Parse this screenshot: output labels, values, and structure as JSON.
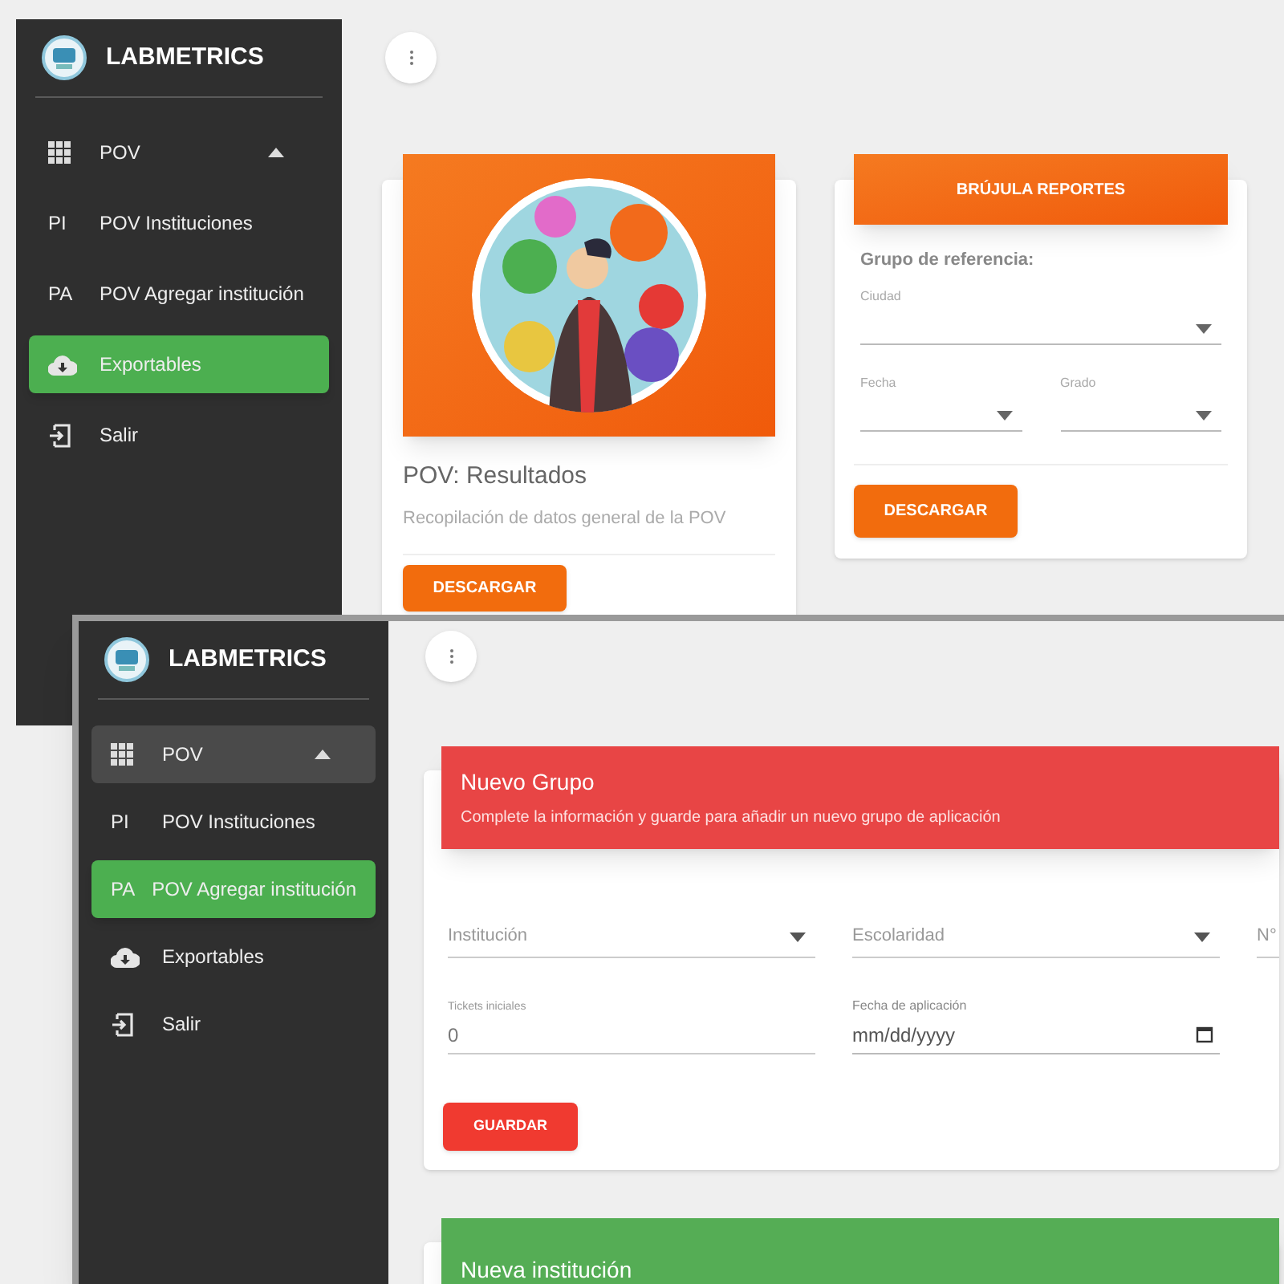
{
  "back_screen": {
    "sidebar": {
      "brand": "LABMETRICS",
      "items": [
        {
          "kind": "group",
          "label": "POV",
          "expanded": true,
          "highlighted": false,
          "selected": false
        },
        {
          "kind": "subitem",
          "abbr": "PI",
          "label": "POV Instituciones",
          "selected": false
        },
        {
          "kind": "subitem",
          "abbr": "PA",
          "label": "POV Agregar institución",
          "selected": false
        },
        {
          "kind": "download",
          "label": "Exportables",
          "selected": true
        },
        {
          "kind": "logout",
          "label": "Salir",
          "selected": false
        }
      ]
    },
    "cards": [
      {
        "title": "POV: Resultados",
        "subtitle": "Recopilación de datos general de la POV",
        "button": "DESCARGAR"
      },
      {
        "kind": "form",
        "header": "BRÚJULA REPORTES",
        "section_label": "Grupo de referencia:",
        "fields": [
          {
            "label": "Ciudad"
          },
          {
            "label": "Fecha"
          },
          {
            "label": "Grado"
          }
        ],
        "button": "DESCARGAR"
      }
    ]
  },
  "front_screen": {
    "sidebar": {
      "brand": "LABMETRICS",
      "items": [
        {
          "kind": "group",
          "label": "POV",
          "expanded": true,
          "highlighted": true,
          "selected": false
        },
        {
          "kind": "subitem",
          "abbr": "PI",
          "label": "POV Instituciones",
          "selected": false
        },
        {
          "kind": "subitem",
          "abbr": "PA",
          "label": "POV Agregar institución",
          "selected": true
        },
        {
          "kind": "download",
          "label": "Exportables",
          "selected": false
        },
        {
          "kind": "logout",
          "label": "Salir",
          "selected": false
        }
      ]
    },
    "cards": [
      {
        "title": "Nuevo Grupo",
        "subtitle": "Complete la información y guarde para añadir un nuevo grupo de aplicación",
        "color": "#e84545",
        "rows": [
          [
            {
              "kind": "select",
              "placeholder": "Institución"
            },
            {
              "kind": "select",
              "placeholder": "Escolaridad"
            },
            {
              "kind": "partial",
              "placeholder": "N°"
            }
          ],
          [
            {
              "kind": "number",
              "label": "Tickets iniciales",
              "value": "0"
            },
            {
              "kind": "date",
              "label": "Fecha de aplicación",
              "placeholder": "mm/dd/yyyy"
            }
          ]
        ],
        "button": "GUARDAR"
      },
      {
        "title": "Nueva institución",
        "color": "#55ad55"
      }
    ]
  }
}
